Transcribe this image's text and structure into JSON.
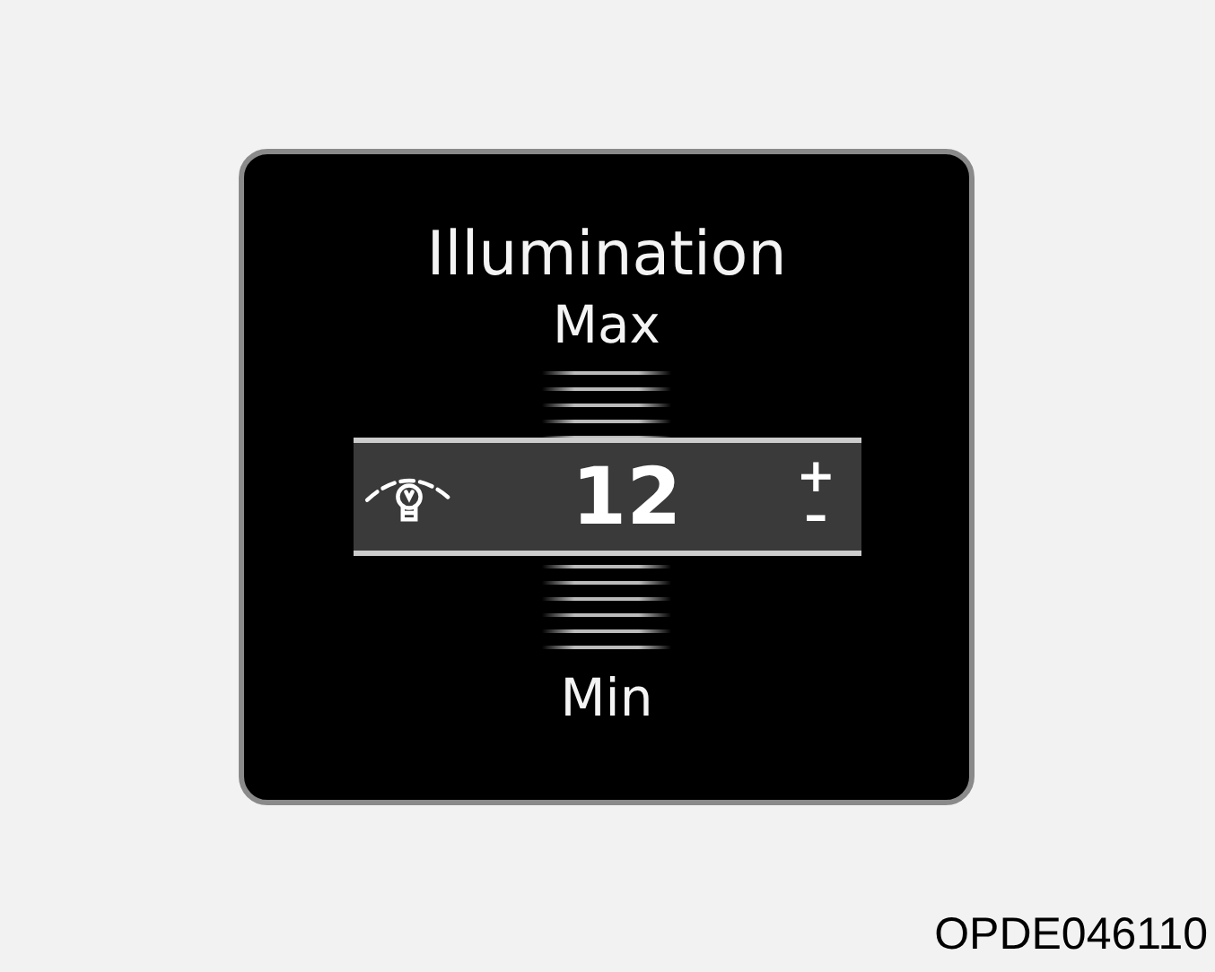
{
  "display": {
    "title": "Illumination",
    "max_label": "Max",
    "min_label": "Min",
    "value": "12",
    "plus": "+",
    "minus": "–"
  },
  "figure_code": "OPDE046110"
}
